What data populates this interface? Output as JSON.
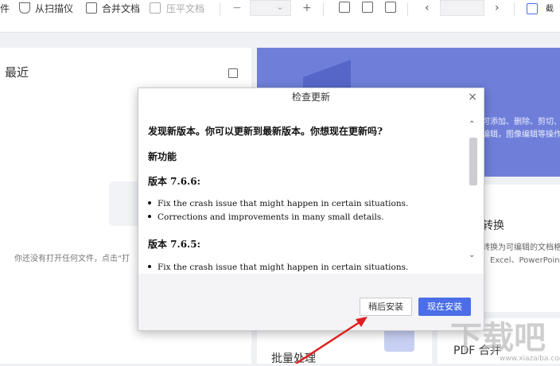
{
  "toolbar": {
    "file_partial": "件",
    "scan": "从扫描仪",
    "merge": "合并文档",
    "flatten": "压平文档",
    "minus": "−",
    "plus": "+",
    "prev": "‹",
    "next": "›",
    "screenshot_partial": "截"
  },
  "recent": {
    "title": "最近",
    "empty_message": "你还没有打开任何文件，点击“打"
  },
  "right_cards": {
    "banner_line1": "可添加、删除、剪切、",
    "banner_line2": "编辑，图像编辑等操作",
    "convert_title": "转换",
    "convert_line1": "转换为可编辑的文档格",
    "convert_line2": "、Excel、PowerPoin",
    "batch_title": "批量处理",
    "merge_title": "PDF 合并"
  },
  "dialog": {
    "title": "检查更新",
    "close": "×",
    "headline": "发现新版本。你可以更新到最新版本。你想现在更新吗?",
    "section_new": "新功能",
    "v1_heading": "版本  7.6.6:",
    "v1_items": [
      "Fix the crash issue that might happen in certain situations.",
      "Corrections and improvements in many small details."
    ],
    "v2_heading": "版本  7.6.5:",
    "v2_items": [
      "Fix the crash issue that might happen in certain situations."
    ],
    "scroll_up": "⌃",
    "scroll_down": "⌄",
    "later_button": "稍后安装",
    "now_button": "现在安装"
  },
  "watermark": {
    "text": "下载吧",
    "sub": "www.xiazaiba.com"
  },
  "colors": {
    "accent": "#4b6ee8",
    "banner": "#6f7fd9",
    "arrow": "#e02020"
  }
}
